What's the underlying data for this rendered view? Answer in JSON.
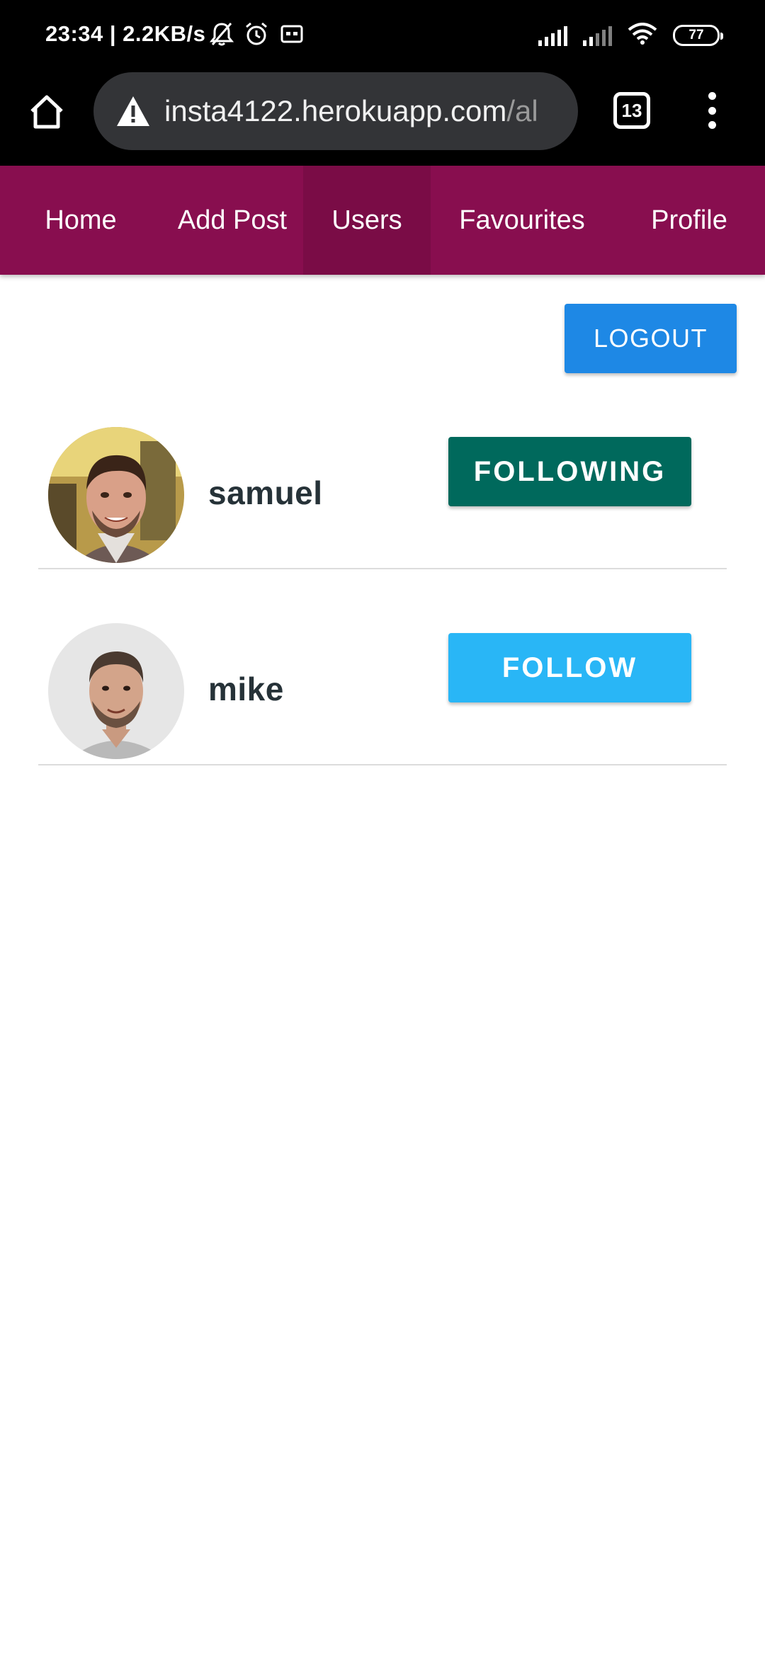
{
  "status_bar": {
    "time_speed": "23:34 | 2.2KB/s",
    "battery": "77",
    "icons": [
      "bell-off-icon",
      "alarm-icon",
      "vr-icon",
      "signal-icon",
      "signal-icon",
      "wifi-icon",
      "battery-icon"
    ]
  },
  "browser": {
    "url_main": "insta4122.herokuapp.com",
    "url_rest": "/al",
    "tab_count": "13",
    "icons": [
      "home-icon",
      "warning-icon",
      "tabs-icon",
      "more-vert-icon"
    ]
  },
  "nav": {
    "items": [
      {
        "label": "Home",
        "active": false
      },
      {
        "label": "Add Post",
        "active": false
      },
      {
        "label": "Users",
        "active": true
      },
      {
        "label": "Favourites",
        "active": false
      },
      {
        "label": "Profile",
        "active": false
      }
    ]
  },
  "logout_label": "LOGOUT",
  "users": [
    {
      "name": "samuel",
      "button_label": "FOLLOWING",
      "button_color": "#00695c"
    },
    {
      "name": "mike",
      "button_label": "FOLLOW",
      "button_color": "#29b6f6"
    }
  ],
  "colors": {
    "nav_bg": "#880e4f",
    "nav_active": "#7a0c46",
    "logout": "#1e88e5",
    "following": "#00695c",
    "follow": "#29b6f6"
  }
}
